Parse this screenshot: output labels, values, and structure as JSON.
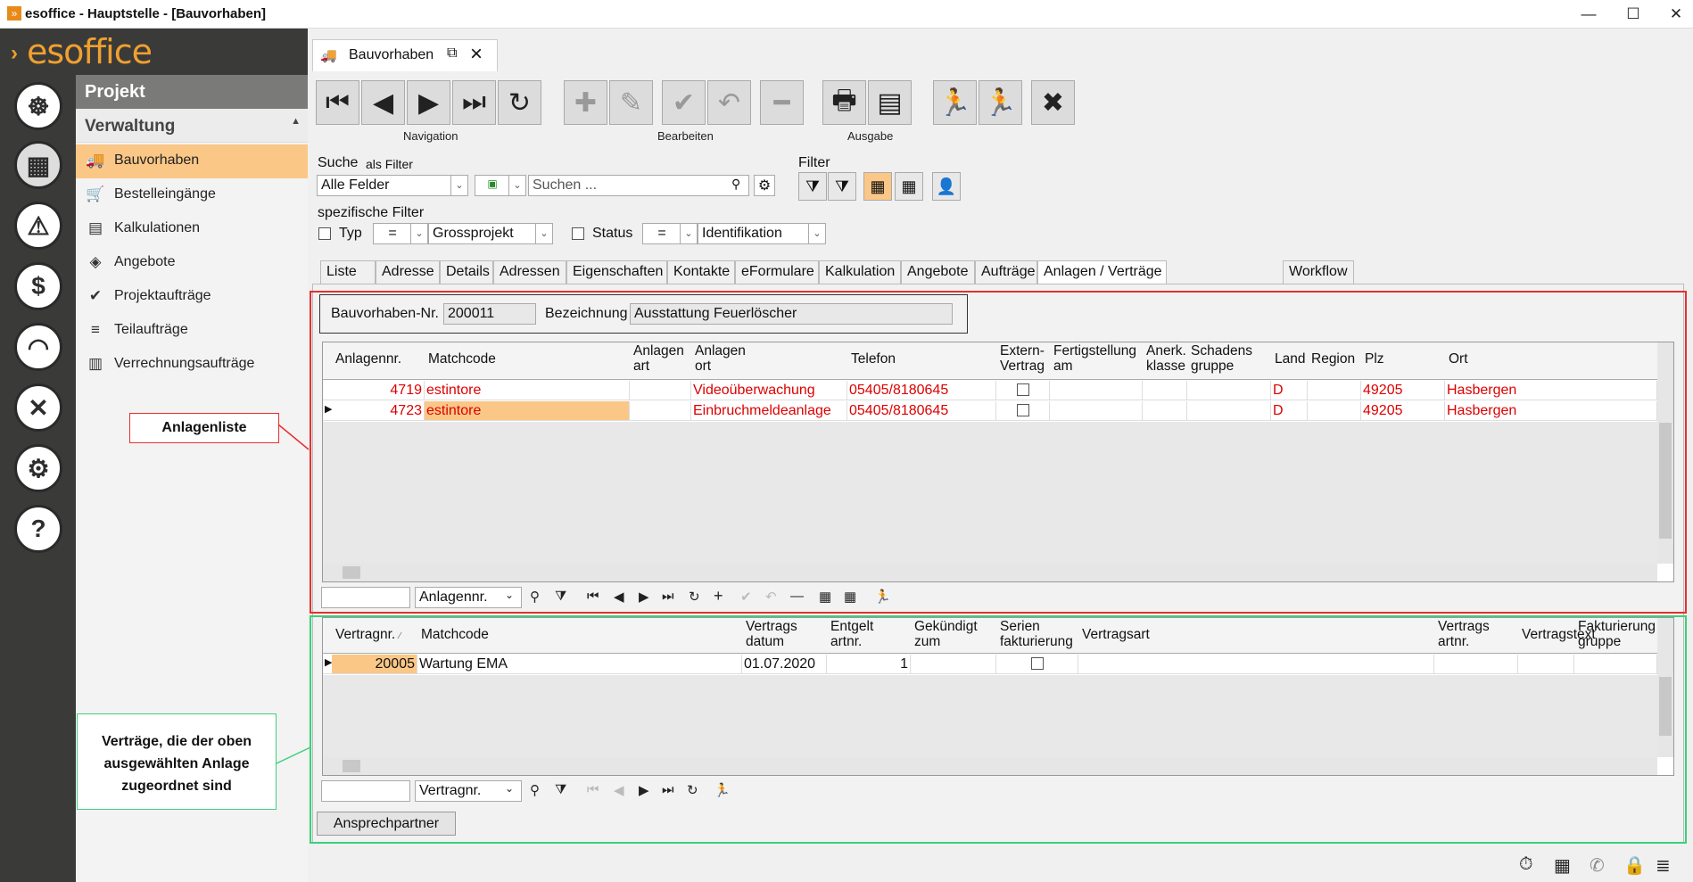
{
  "window": {
    "title": "esoffice - Hauptstelle - [Bauvorhaben]",
    "min": "—",
    "max": "☐",
    "close": "✕"
  },
  "logo": "esoffice",
  "sidebar": {
    "header": "Projekt",
    "section": "Verwaltung",
    "items": [
      {
        "label": "Bauvorhaben",
        "icon": "truck-icon"
      },
      {
        "label": "Bestelleingänge",
        "icon": "cart-icon"
      },
      {
        "label": "Kalkulationen",
        "icon": "document-icon"
      },
      {
        "label": "Angebote",
        "icon": "tag-icon"
      },
      {
        "label": "Projektaufträge",
        "icon": "check-circle-icon"
      },
      {
        "label": "Teilaufträge",
        "icon": "stack-icon"
      },
      {
        "label": "Verrechnungsaufträge",
        "icon": "invoice-icon"
      }
    ]
  },
  "doc_tab": {
    "label": "Bauvorhaben"
  },
  "toolbar": {
    "groups": {
      "navigation": "Navigation",
      "edit": "Bearbeiten",
      "output": "Ausgabe"
    }
  },
  "search": {
    "label": "Suche",
    "as_filter": "als Filter",
    "field": "Alle Felder",
    "placeholder": "Suchen ..."
  },
  "filter": {
    "label": "Filter"
  },
  "specific": {
    "label": "spezifische Filter",
    "typ_label": "Typ",
    "typ_op": "=",
    "typ_value": "Grossprojekt",
    "status_label": "Status",
    "status_op": "=",
    "status_value": "Identifikation"
  },
  "tabs": [
    "Liste",
    "Adresse",
    "Details",
    "Adressen",
    "Eigenschaften",
    "Kontakte",
    "eFormulare",
    "Kalkulation",
    "Angebote",
    "Aufträge",
    "Anlagen / Verträge",
    "Workflow"
  ],
  "project": {
    "nr_label": "Bauvorhaben-Nr.",
    "nr": "200011",
    "bez_label": "Bezeichnung",
    "bez": "Ausstattung Feuerlöscher"
  },
  "anlagen": {
    "columns": [
      [
        "Anlagennr.",
        ""
      ],
      [
        "Matchcode",
        ""
      ],
      [
        "Anlagen",
        "art"
      ],
      [
        "Anlagen",
        "ort"
      ],
      [
        "Telefon",
        ""
      ],
      [
        "Extern-",
        "Vertrag"
      ],
      [
        "Fertigstellung",
        "am"
      ],
      [
        "Anerk.",
        "klasse"
      ],
      [
        "Schadens",
        "gruppe"
      ],
      [
        "Land",
        ""
      ],
      [
        "Region",
        ""
      ],
      [
        "Plz",
        ""
      ],
      [
        "Ort",
        ""
      ]
    ],
    "rows": [
      {
        "nr": "4719",
        "match": "estintore",
        "art": "",
        "ort": "Videoüberwachung",
        "tel": "05405/8180645",
        "land": "D",
        "plz": "49205",
        "city": "Hasbergen"
      },
      {
        "nr": "4723",
        "match": "estintore",
        "art": "",
        "ort": "Einbruchmeldeanlage",
        "tel": "05405/8180645",
        "land": "D",
        "plz": "49205",
        "city": "Hasbergen"
      }
    ],
    "sort_field": "Anlagennr."
  },
  "vertraege": {
    "columns": [
      [
        "Vertragnr.",
        ""
      ],
      [
        "Matchcode",
        ""
      ],
      [
        "Vertrags",
        "datum"
      ],
      [
        "Entgelt",
        "artnr."
      ],
      [
        "Gekündigt",
        "zum"
      ],
      [
        "Serien",
        "fakturierung"
      ],
      [
        "Vertragsart",
        ""
      ],
      [
        "Vertrags",
        "artnr."
      ],
      [
        "Vertragstext",
        ""
      ],
      [
        "Fakturierung",
        "gruppe"
      ]
    ],
    "rows": [
      {
        "nr": "20005",
        "match": "Wartung EMA",
        "datum": "01.07.2020",
        "entgelt": "1"
      }
    ],
    "sort_field": "Vertragnr."
  },
  "callouts": {
    "anlagen": "Anlagenliste",
    "vertraege": "Verträge, die der oben ausgewählten Anlage zugeordnet sind"
  },
  "ansprechpartner_button": "Ansprechpartner"
}
